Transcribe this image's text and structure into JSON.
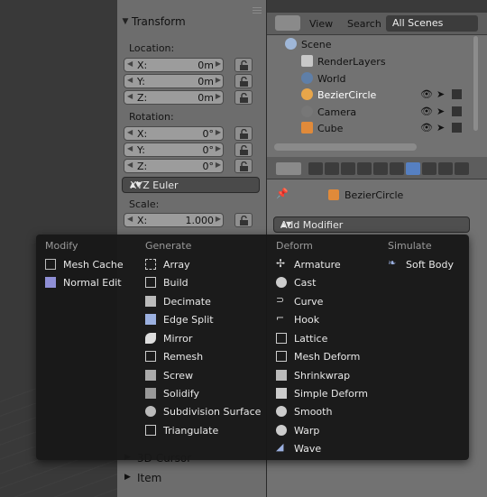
{
  "npanel": {
    "transform_title": "Transform",
    "location_label": "Location:",
    "location": [
      {
        "axis": "X:",
        "value": "0m"
      },
      {
        "axis": "Y:",
        "value": "0m"
      },
      {
        "axis": "Z:",
        "value": "0m"
      }
    ],
    "rotation_label": "Rotation:",
    "rotation": [
      {
        "axis": "X:",
        "value": "0°"
      },
      {
        "axis": "Y:",
        "value": "0°"
      },
      {
        "axis": "Z:",
        "value": "0°"
      }
    ],
    "rotation_mode": "XYZ Euler",
    "scale_label": "Scale:",
    "scale": [
      {
        "axis": "X:",
        "value": "1.000"
      }
    ],
    "panel_3d_cursor": "3D Cursor",
    "panel_item": "Item"
  },
  "outliner": {
    "view_label": "View",
    "search_label": "Search",
    "filter_value": "All Scenes",
    "rows": [
      {
        "name": "Scene",
        "icon": "scene-icon"
      },
      {
        "name": "RenderLayers",
        "icon": "renderlayers-icon"
      },
      {
        "name": "World",
        "icon": "world-icon"
      },
      {
        "name": "BezierCircle",
        "icon": "curve-icon"
      },
      {
        "name": "Camera",
        "icon": "camera-icon"
      },
      {
        "name": "Cube",
        "icon": "cube-icon"
      }
    ]
  },
  "properties": {
    "breadcrumb_object": "BezierCircle",
    "add_modifier": "Add Modifier"
  },
  "menu": {
    "modify_head": "Modify",
    "generate_head": "Generate",
    "deform_head": "Deform",
    "simulate_head": "Simulate",
    "modify": [
      "Mesh Cache",
      "Normal Edit"
    ],
    "generate": [
      "Array",
      "Build",
      "Decimate",
      "Edge Split",
      "Mirror",
      "Remesh",
      "Screw",
      "Solidify",
      "Subdivision Surface",
      "Triangulate"
    ],
    "deform": [
      "Armature",
      "Cast",
      "Curve",
      "Hook",
      "Lattice",
      "Mesh Deform",
      "Shrinkwrap",
      "Simple Deform",
      "Smooth",
      "Warp",
      "Wave"
    ],
    "simulate": [
      "Soft Body"
    ]
  },
  "colors": {
    "selection_text": "#ffffff",
    "menu_bg": "#181818",
    "accent_blue": "#5680c2"
  }
}
